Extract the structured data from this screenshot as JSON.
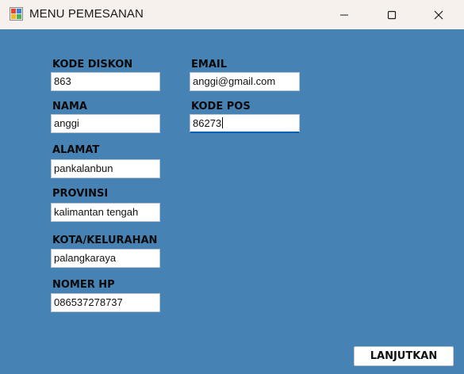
{
  "window": {
    "title": "MENU PEMESANAN",
    "icon": "form-icon",
    "controls": [
      "minimize-icon",
      "maximize-icon",
      "close-icon"
    ]
  },
  "form": {
    "kode_diskon": {
      "label": "KODE DISKON",
      "value": "863"
    },
    "nama": {
      "label": "NAMA",
      "value": "anggi"
    },
    "alamat": {
      "label": "ALAMAT",
      "value": "pankalanbun"
    },
    "provinsi": {
      "label": "PROVINSI",
      "value": "kalimantan tengah"
    },
    "kota": {
      "label": "KOTA/KELURAHAN",
      "value": "palangkaraya"
    },
    "nomer_hp": {
      "label": "NOMER HP",
      "value": "086537278737"
    },
    "email": {
      "label": "EMAIL",
      "value": "anggi@gmail.com"
    },
    "kode_pos": {
      "label": "KODE POS",
      "value": "86273"
    }
  },
  "buttons": {
    "next_label": "LANJUTKAN"
  },
  "colors": {
    "background": "#4682b4",
    "titlebar": "#f6f1ec",
    "focus_accent": "#005fb8"
  }
}
